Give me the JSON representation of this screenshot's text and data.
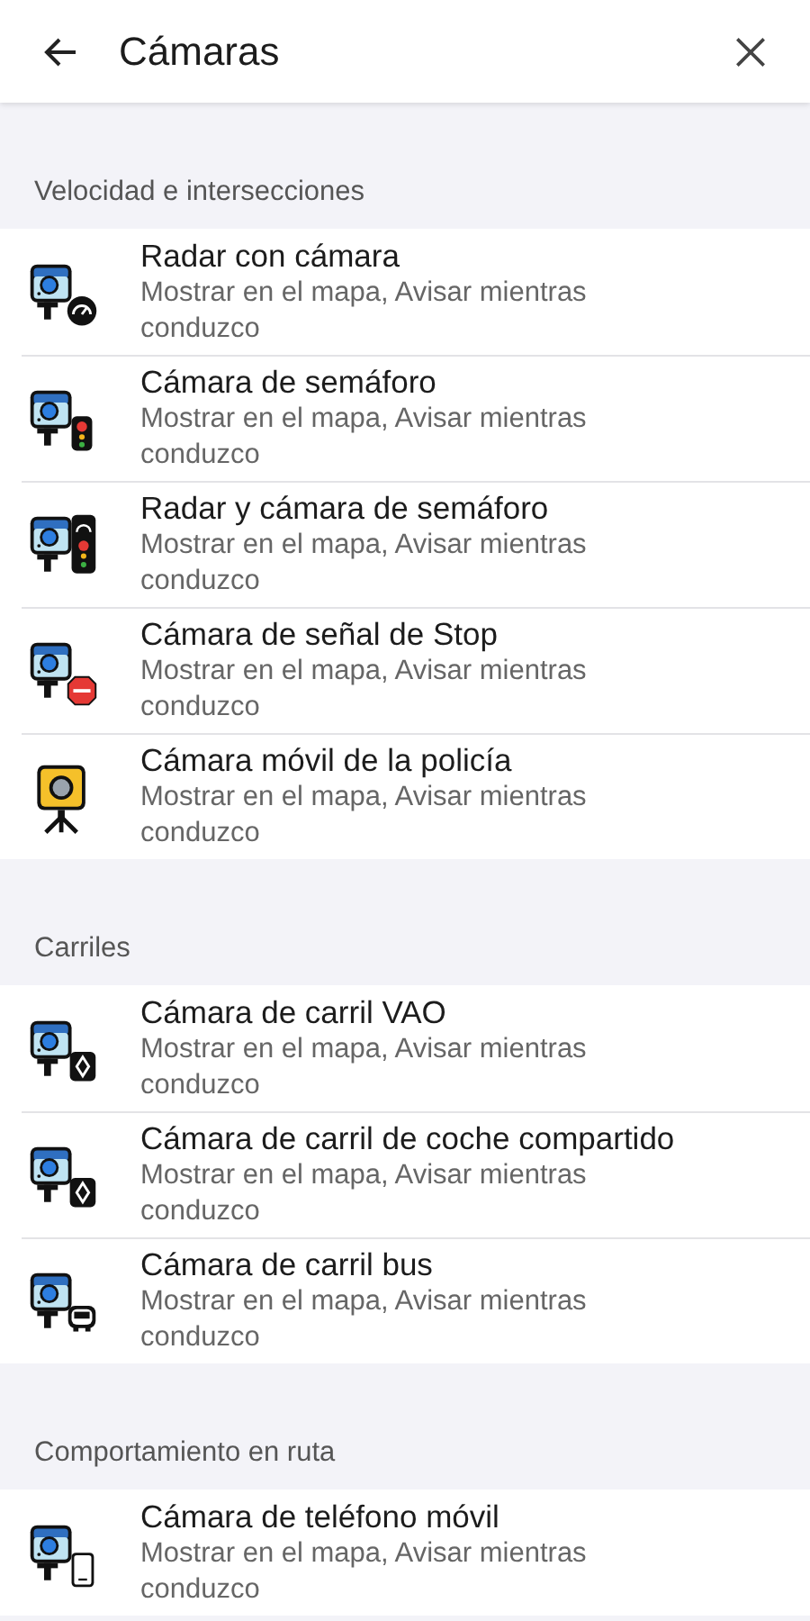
{
  "header": {
    "title": "Cámaras"
  },
  "sections": [
    {
      "title": "Velocidad e intersecciones",
      "items": [
        {
          "kind": "speed",
          "title": "Radar con cámara",
          "subtitle": "Mostrar en el mapa, Avisar mientras conduzco"
        },
        {
          "kind": "traffic-light",
          "title": "Cámara de semáforo",
          "subtitle": "Mostrar en el mapa, Avisar mientras conduzco"
        },
        {
          "kind": "speed-light",
          "title": "Radar y cámara de semáforo",
          "subtitle": "Mostrar en el mapa, Avisar mientras conduzco"
        },
        {
          "kind": "stop",
          "title": "Cámara de señal de Stop",
          "subtitle": "Mostrar en el mapa, Avisar mientras conduzco"
        },
        {
          "kind": "mobile",
          "title": "Cámara móvil de la policía",
          "subtitle": "Mostrar en el mapa, Avisar mientras conduzco"
        }
      ]
    },
    {
      "title": "Carriles",
      "items": [
        {
          "kind": "lane",
          "title": "Cámara de carril VAO",
          "subtitle": "Mostrar en el mapa, Avisar mientras conduzco"
        },
        {
          "kind": "lane",
          "title": "Cámara de carril de coche compartido",
          "subtitle": "Mostrar en el mapa, Avisar mientras conduzco"
        },
        {
          "kind": "bus",
          "title": "Cámara de carril bus",
          "subtitle": "Mostrar en el mapa, Avisar mientras conduzco"
        }
      ]
    },
    {
      "title": "Comportamiento en ruta",
      "items": [
        {
          "kind": "phone",
          "title": "Cámara de teléfono móvil",
          "subtitle": "Mostrar en el mapa, Avisar mientras conduzco"
        }
      ]
    }
  ]
}
